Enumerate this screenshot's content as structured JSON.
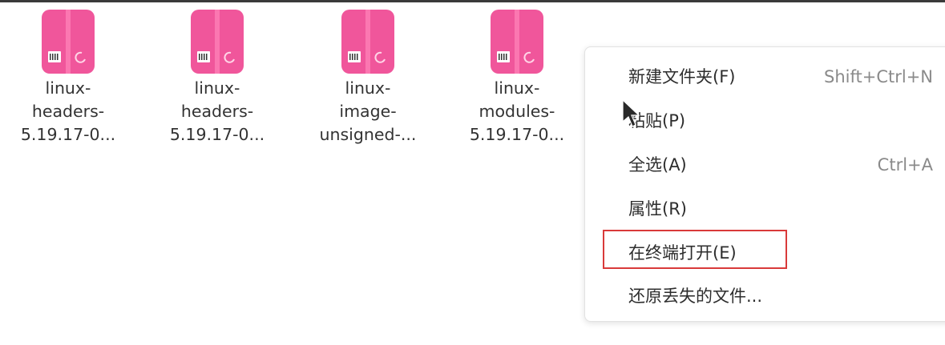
{
  "files": [
    {
      "name_lines": [
        "linux-",
        "headers-",
        "5.19.17-0..."
      ]
    },
    {
      "name_lines": [
        "linux-",
        "headers-",
        "5.19.17-0..."
      ]
    },
    {
      "name_lines": [
        "linux-",
        "image-",
        "unsigned-..."
      ]
    },
    {
      "name_lines": [
        "linux-",
        "modules-",
        "5.19.17-0..."
      ]
    }
  ],
  "context_menu": {
    "items": [
      {
        "label": "新建文件夹(F)",
        "shortcut": "Shift+Ctrl+N"
      },
      {
        "label": "粘贴(P)",
        "shortcut": ""
      },
      {
        "label": "全选(A)",
        "shortcut": "Ctrl+A"
      },
      {
        "label": "属性(R)",
        "shortcut": ""
      },
      {
        "label": "在终端打开(E)",
        "shortcut": "",
        "highlighted": true
      },
      {
        "label": "还原丢失的文件...",
        "shortcut": ""
      }
    ]
  },
  "colors": {
    "package_icon": "#f0569b",
    "highlight_border": "#d93a3a"
  },
  "icons": {
    "file_icon": "debian-package-icon",
    "cursor": "mouse-pointer-icon"
  }
}
